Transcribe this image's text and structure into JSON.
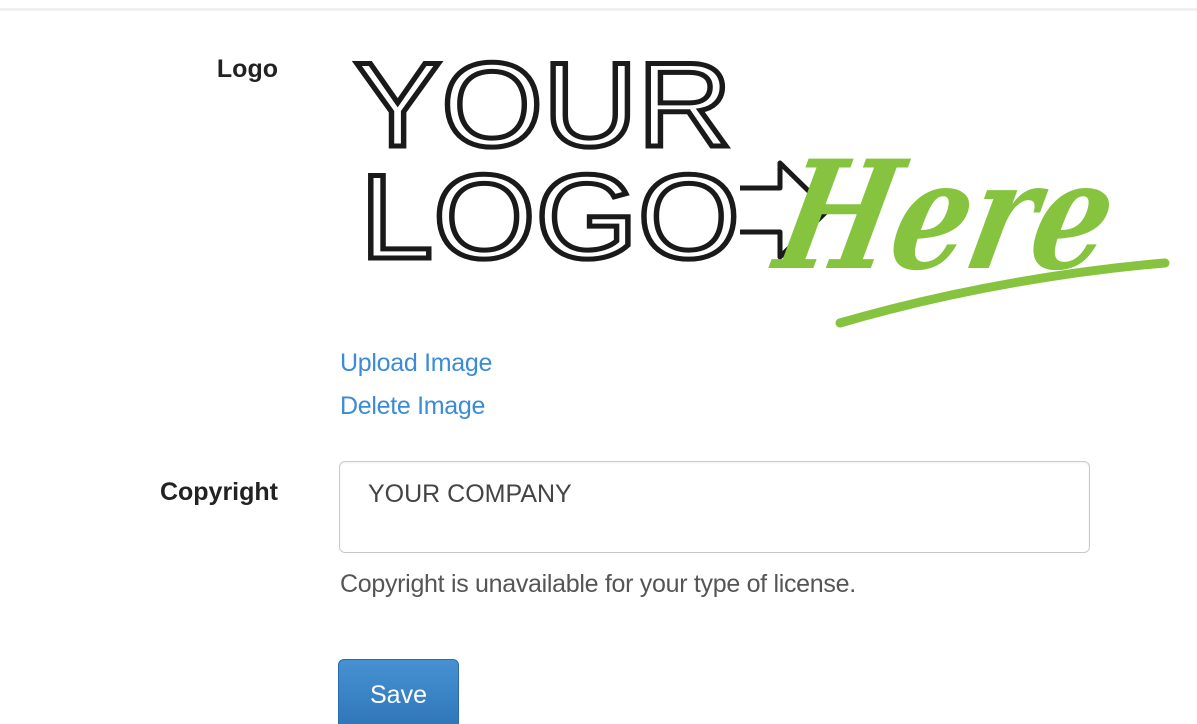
{
  "form": {
    "logo_label": "Logo",
    "copyright_label": "Copyright"
  },
  "logo_image": {
    "line1": "YOUR",
    "line2": "LOGO",
    "script_word": "Here",
    "colors": {
      "dark": "#1a1a1a",
      "green": "#86c440"
    }
  },
  "links": {
    "upload": "Upload Image",
    "delete": "Delete Image"
  },
  "copyright_input": {
    "value": "YOUR COMPANY"
  },
  "help_text": "Copyright is unavailable for your type of license.",
  "save_label": "Save",
  "colors": {
    "link": "#3b8bd6",
    "button": "#337ab7"
  }
}
